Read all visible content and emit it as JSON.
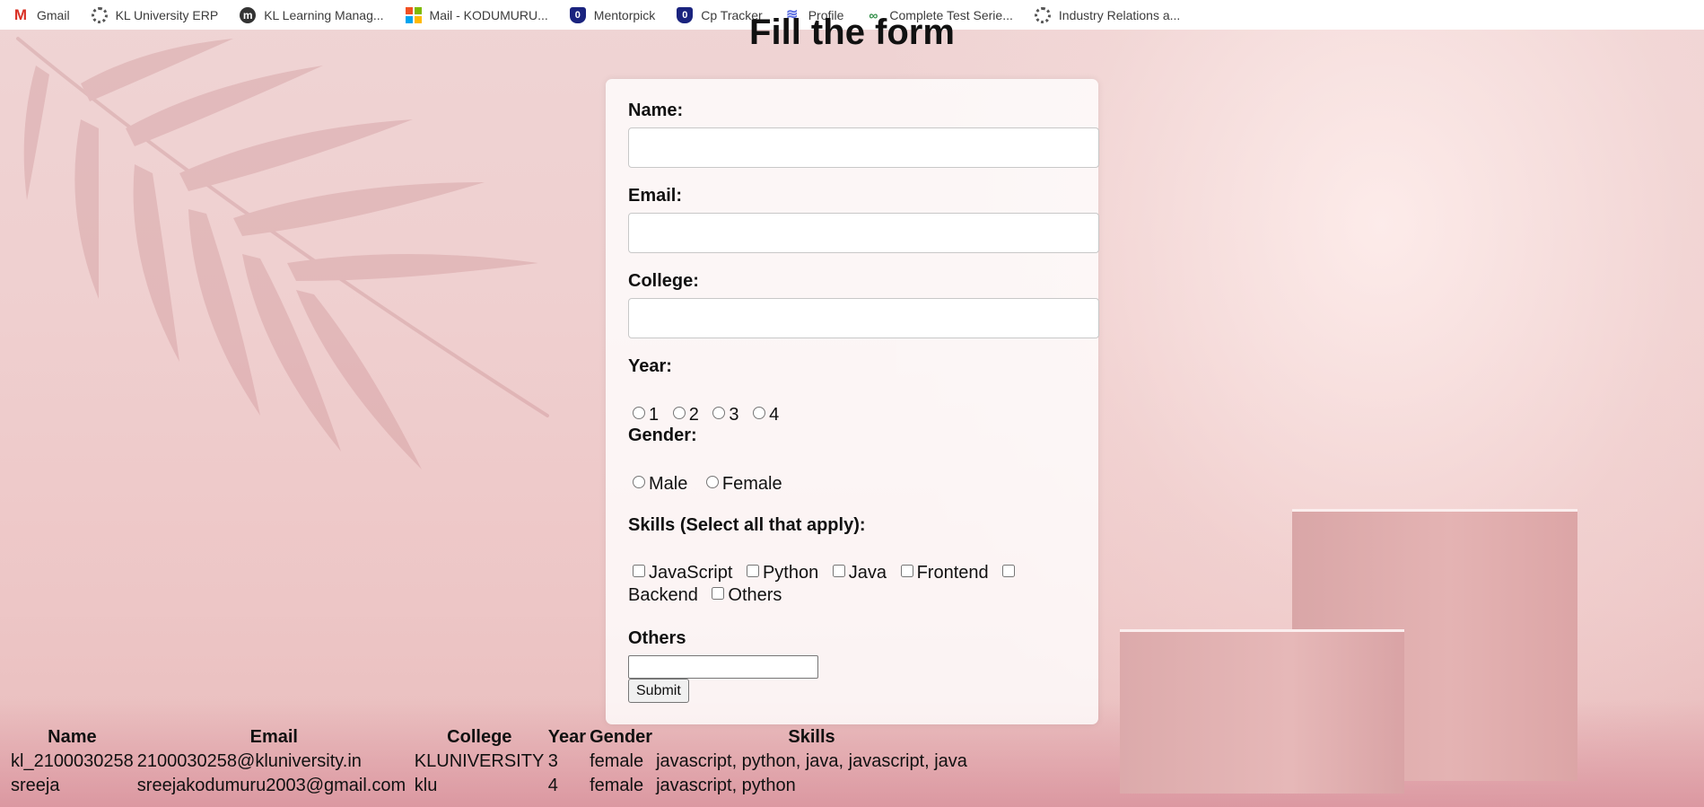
{
  "bookmarks": [
    {
      "label": "Gmail",
      "icon": "gmail-icon"
    },
    {
      "label": "KL University ERP",
      "icon": "gear-icon"
    },
    {
      "label": "KL Learning Manag...",
      "icon": "m-icon"
    },
    {
      "label": "Mail - KODUMURU...",
      "icon": "microsoft-icon"
    },
    {
      "label": "Mentorpick",
      "icon": "shield-icon"
    },
    {
      "label": "Cp Tracker",
      "icon": "shield-icon"
    },
    {
      "label": "Profile",
      "icon": "profile-icon"
    },
    {
      "label": "Complete Test Serie...",
      "icon": "gfg-icon"
    },
    {
      "label": "Industry Relations a...",
      "icon": "gear-icon"
    }
  ],
  "page": {
    "title": "Fill the form"
  },
  "form": {
    "name_label": "Name:",
    "email_label": "Email:",
    "college_label": "College:",
    "year_label": "Year:",
    "year_options": [
      "1",
      "2",
      "3",
      "4"
    ],
    "gender_label": "Gender:",
    "gender_options": [
      "Male",
      "Female"
    ],
    "skills_label": "Skills (Select all that apply):",
    "skill_options": [
      "JavaScript",
      "Python",
      "Java",
      "Frontend",
      "Backend",
      "Others"
    ],
    "others_label": "Others",
    "submit_label": "Submit"
  },
  "table": {
    "headers": [
      "Name",
      "Email",
      "College",
      "Year",
      "Gender",
      "Skills"
    ],
    "rows": [
      [
        "kl_2100030258",
        "2100030258@kluniversity.in",
        "KLUNIVERSITY",
        "3",
        "female",
        "javascript, python, java, javascript, java"
      ],
      [
        "sreeja",
        "sreejakodumuru2003@gmail.com",
        "klu",
        "4",
        "female",
        "javascript, python"
      ]
    ]
  },
  "colors": {
    "microsoft": [
      "#f25022",
      "#7fba00",
      "#00a4ef",
      "#ffb900"
    ]
  }
}
